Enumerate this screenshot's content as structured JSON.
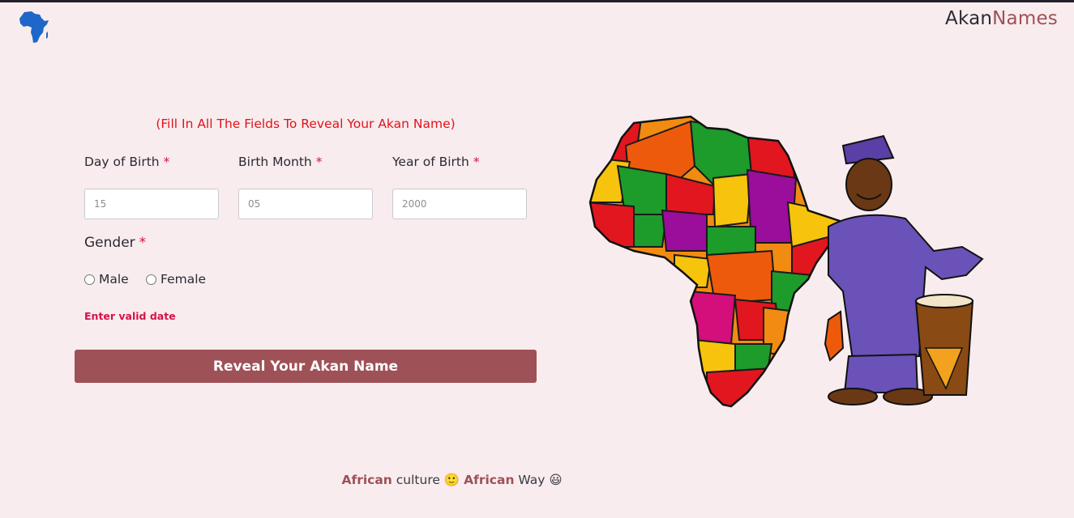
{
  "brand": {
    "part1": "Akan",
    "part2": "Names"
  },
  "form": {
    "notice": "(Fill In All The Fields To Reveal Your Akan Name)",
    "day": {
      "label": "Day of Birth",
      "placeholder": "15"
    },
    "month": {
      "label": "Birth Month",
      "placeholder": "05"
    },
    "year": {
      "label": "Year of Birth",
      "placeholder": "2000"
    },
    "required_mark": "*",
    "gender": {
      "label": "Gender",
      "options": [
        "Male",
        "Female"
      ]
    },
    "error": "Enter valid date",
    "submit_label": "Reveal Your Akan Name"
  },
  "footer": {
    "word1": "African",
    "text1": "culture",
    "emoji1": "🙂",
    "word2": "African",
    "text2": "Way",
    "emoji2": "😃"
  },
  "colors": {
    "background": "#f8ecee",
    "accent": "#9e5157",
    "error": "#d3124a",
    "notice": "#e0131b"
  },
  "icons": [
    "africa-logo-icon",
    "africa-map-illustration"
  ]
}
